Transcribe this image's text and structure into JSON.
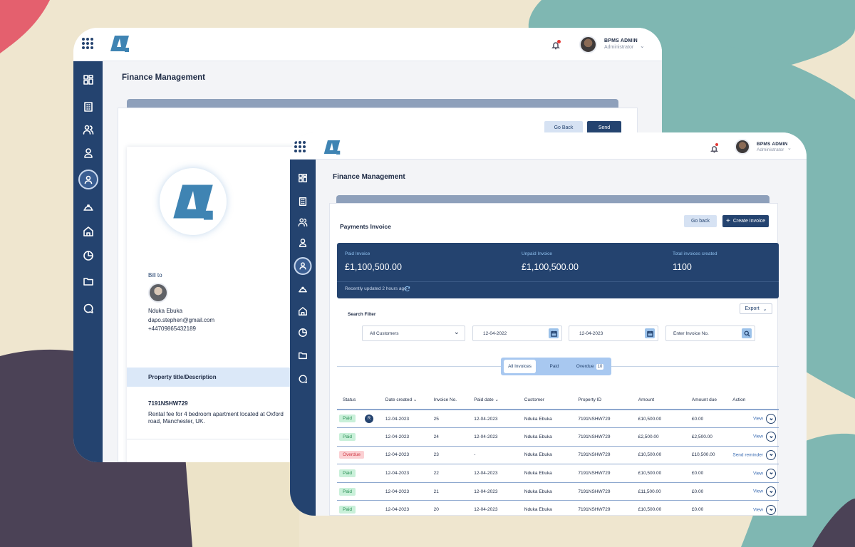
{
  "colors": {
    "primary": "#24436f",
    "accent_light": "#a8c8f0",
    "paid_bg": "#c9f0d9",
    "overdue_bg": "#fbd0d3",
    "bell_dot": "#e53935"
  },
  "back": {
    "user": {
      "name": "BPMS ADMIN",
      "role": "Administrator"
    },
    "page_title": "Finance Management",
    "buttons": {
      "go_back": "Go Back",
      "send": "Send"
    },
    "bill_to": {
      "label": "Bill to",
      "name": "Nduka Ebuka",
      "email": "dapo.stephen@gmail.com",
      "phone": "+44709865432189"
    },
    "section_header": "Property title/Description",
    "property_id": "7191NSHW729",
    "description": "Rental fee for 4 bedroom apartment located at Oxford road, Manchester, UK."
  },
  "front": {
    "user": {
      "name": "BPMS ADMIN",
      "role": "Administrator"
    },
    "page_title": "Finance Management",
    "card_title": "Payments Invoice",
    "buttons": {
      "go_back": "Go back",
      "create": "Create Invoice",
      "export": "Export"
    },
    "summary": {
      "paid_label": "Paid Invoice",
      "paid_value": "£1,100,500.00",
      "unpaid_label": "Unpaid Invoice",
      "unpaid_value": "£1,100,500.00",
      "total_label": "Total invoices created",
      "total_value": "1100",
      "updated": "Recently updated 2 hours ago"
    },
    "filter": {
      "label": "Search Filter",
      "customers": "All Customers",
      "date_from": "12-04-2022",
      "date_to": "12-04-2023",
      "invoice_placeholder": "Enter Invoice No."
    },
    "tabs": {
      "all": "All Invoices",
      "paid": "Paid",
      "overdue": "Overdue",
      "overdue_count": "10"
    },
    "columns": [
      "Status",
      "Date created",
      "Invoice No.",
      "Paid date",
      "Customer",
      "Property ID",
      "Amount",
      "Amount due",
      "Action"
    ],
    "rows": [
      {
        "status": "Paid",
        "badge": "R",
        "date": "12-04-2023",
        "invoice": "25",
        "paid_date": "12-04-2023",
        "customer": "Nduka Ebuka",
        "property": "7191NSHW729",
        "amount": "£10,500.00",
        "due": "£0.00",
        "action": "View"
      },
      {
        "status": "Paid",
        "badge": "",
        "date": "12-04-2023",
        "invoice": "24",
        "paid_date": "12-04-2023",
        "customer": "Nduka Ebuka",
        "property": "7191NSHW729",
        "amount": "£2,500.00",
        "due": "£2,500.00",
        "action": "View"
      },
      {
        "status": "Overdue",
        "badge": "",
        "date": "12-04-2023",
        "invoice": "23",
        "paid_date": "-",
        "customer": "Nduka Ebuka",
        "property": "7191NSHW729",
        "amount": "£10,500.00",
        "due": "£10,500.00",
        "action": "Send reminder"
      },
      {
        "status": "Paid",
        "badge": "",
        "date": "12-04-2023",
        "invoice": "22",
        "paid_date": "12-04-2023",
        "customer": "Nduka Ebuka",
        "property": "7191NSHW729",
        "amount": "£10,500.00",
        "due": "£0.00",
        "action": "View"
      },
      {
        "status": "Paid",
        "badge": "",
        "date": "12-04-2023",
        "invoice": "21",
        "paid_date": "12-04-2023",
        "customer": "Nduka Ebuka",
        "property": "7191NSHW729",
        "amount": "£11,500.00",
        "due": "£0.00",
        "action": "View"
      },
      {
        "status": "Paid",
        "badge": "",
        "date": "12-04-2023",
        "invoice": "20",
        "paid_date": "12-04-2023",
        "customer": "Nduka Ebuka",
        "property": "7191NSHW729",
        "amount": "£10,500.00",
        "due": "£0.00",
        "action": "View"
      }
    ]
  }
}
